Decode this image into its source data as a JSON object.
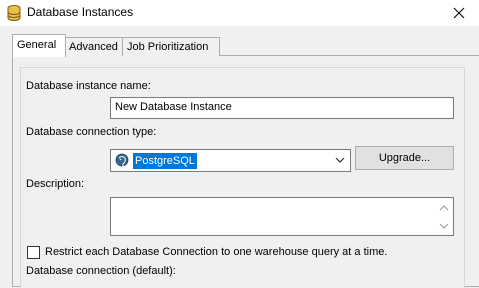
{
  "window": {
    "title": "Database Instances",
    "icon": "database-icon",
    "close_icon": "close-icon"
  },
  "tabs": [
    {
      "label": "General",
      "active": true
    },
    {
      "label": "Advanced",
      "active": false
    },
    {
      "label": "Job Prioritization",
      "active": false
    }
  ],
  "general": {
    "instance_name_label": "Database instance name:",
    "instance_name_value": "New Database Instance",
    "connection_type_label": "Database connection type:",
    "connection_type_value": "PostgreSQL",
    "upgrade_button": "Upgrade...",
    "description_label": "Description:",
    "description_value": "",
    "restrict_checkbox_label": "Restrict each Database Connection to one warehouse query at a time.",
    "restrict_checked": false,
    "default_connection_label": "Database connection (default):"
  },
  "colors": {
    "selection": "#0078d7",
    "window_bg": "#f0f0f0",
    "titlebar_bg": "#ffffff"
  }
}
